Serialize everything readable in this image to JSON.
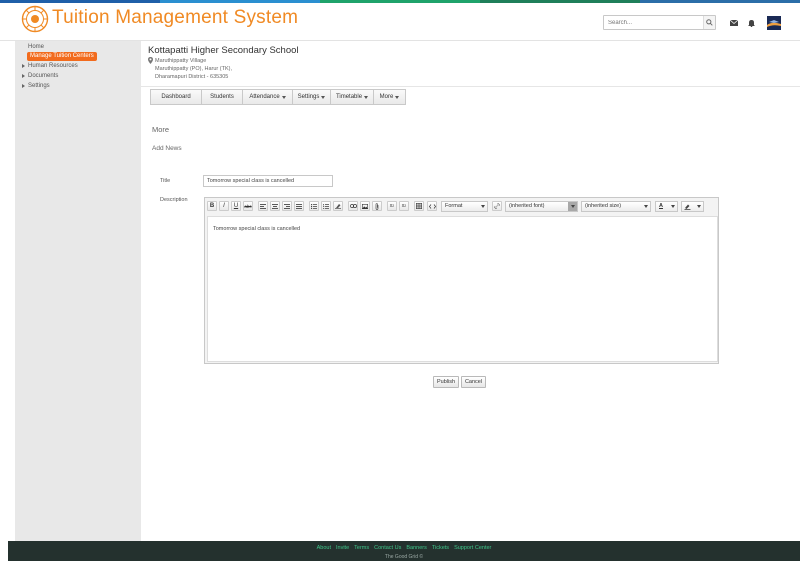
{
  "header": {
    "title": "Tuition Management System",
    "search_placeholder": "Search..."
  },
  "colors": {
    "brand": "#f08a24",
    "active": "#f26b1d",
    "footer_bg": "#24312e",
    "footer_link": "#3fc68a",
    "stripe": [
      "#1f5fa8",
      "#2a8fd0",
      "#1fa36b",
      "#1f7f5a",
      "#2b6ea8"
    ]
  },
  "icons": {
    "logo": "emblem-logo",
    "search": "search-icon",
    "mail": "mail-icon",
    "bell": "bell-icon",
    "location": "map-pin-icon"
  },
  "sidebar": {
    "home": "Home",
    "active_item": "Manage Tuition Centers",
    "items": [
      "Human Resources",
      "Documents",
      "Settings"
    ]
  },
  "school": {
    "name": "Kottapatti Higher Secondary School",
    "address": [
      "Maruthippatty Village",
      "Maruthippatty (PO), Harur (TK),",
      "Dharamapuri District - 635305"
    ]
  },
  "tabs": [
    {
      "label": "Dashboard",
      "dropdown": false
    },
    {
      "label": "Students",
      "dropdown": false
    },
    {
      "label": "Attendance",
      "dropdown": true
    },
    {
      "label": "Settings",
      "dropdown": true
    },
    {
      "label": "Timetable",
      "dropdown": true
    },
    {
      "label": "More",
      "dropdown": true
    }
  ],
  "section": {
    "heading": "More",
    "subheading": "Add News"
  },
  "form": {
    "title_label": "Title",
    "title_value": "Tomorrow special class is cancelled",
    "description_label": "Description",
    "description_value": "Tomorrow special class is cancelled"
  },
  "editor": {
    "buttons": [
      "B",
      "I",
      "U",
      "abc"
    ],
    "format_label": "Format",
    "font_label": "(inherited font)",
    "size_label": "(inherited size)",
    "text_color_label": "A"
  },
  "actions": {
    "publish": "Publish",
    "cancel": "Cancel"
  },
  "footer": {
    "links": [
      "About",
      "Invite",
      "Terms",
      "Contact Us",
      "Banners",
      "Tickets",
      "Support Center"
    ],
    "copyright": "The Good Grid ©"
  }
}
